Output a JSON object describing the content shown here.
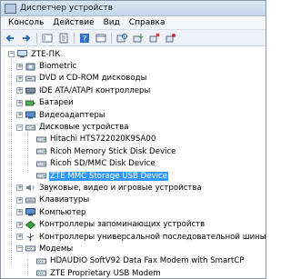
{
  "window": {
    "title": "Диспетчер устройств"
  },
  "menu": {
    "items": [
      "Консоль",
      "Действие",
      "Вид",
      "Справка"
    ]
  },
  "tree": {
    "root": "ZTE-ПК",
    "categories": [
      {
        "label": "Biometric",
        "icon": "biometric-icon"
      },
      {
        "label": "DVD и CD-ROM дисководы",
        "icon": "dvd-icon"
      },
      {
        "label": "IDE ATA/ATAPI контроллеры",
        "icon": "ide-controller-icon"
      },
      {
        "label": "Батареи",
        "icon": "battery-icon"
      },
      {
        "label": "Видеоадаптеры",
        "icon": "display-adapter-icon"
      },
      {
        "label": "Дисковые устройства",
        "icon": "disk-drive-icon",
        "expanded": true,
        "children": [
          "Hitachi HTS722020K9SA00",
          "Ricoh Memory Stick Disk Device",
          "Ricoh SD/MMC Disk Device",
          "ZTE MMC Storage USB Device"
        ],
        "selected_child": "ZTE MMC Storage USB Device"
      },
      {
        "label": "Звуковые, видео и игровые устройства",
        "icon": "sound-icon"
      },
      {
        "label": "Клавиатуры",
        "icon": "keyboard-icon"
      },
      {
        "label": "Компьютер",
        "icon": "computer-icon"
      },
      {
        "label": "Контроллеры запоминающих устройств",
        "icon": "storage-controller-icon"
      },
      {
        "label": "Контроллеры универсальной последовательной шины USB",
        "icon": "usb-icon"
      },
      {
        "label": "Модемы",
        "icon": "modem-icon",
        "expanded": true,
        "children": [
          "HDAUDIO SoftV92 Data Fax Modem with SmartCP",
          "ZTE Proprietary USB Modem"
        ]
      }
    ]
  },
  "colors": {
    "selection": "#3399ff",
    "titlebar": "#c3d5ea"
  }
}
